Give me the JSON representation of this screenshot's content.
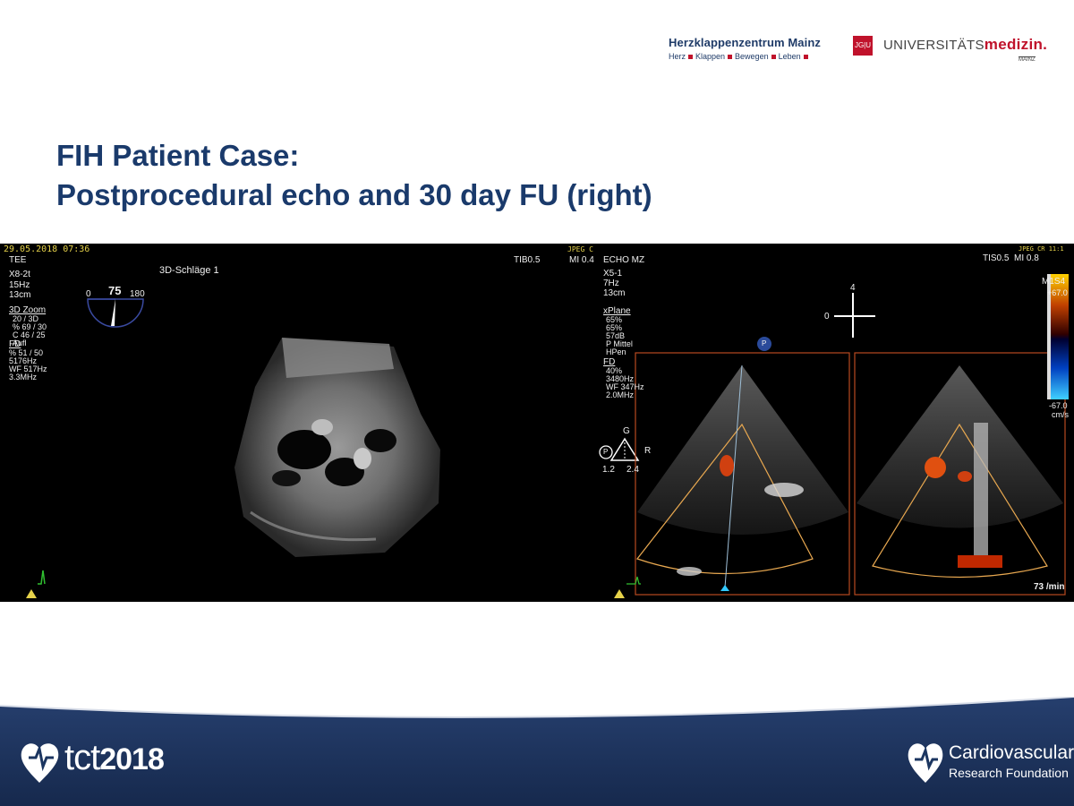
{
  "header": {
    "logo1_name": "Herzklappenzentrum Mainz",
    "logo1_tagline": [
      "Herz",
      "Klappen",
      "Bewegen",
      "Leben"
    ],
    "jgu_mark": "JG|U",
    "unimed_prefix": "UNIVERSITÄTS",
    "unimed_bold": "medizin.",
    "unimed_city": "MAINZ"
  },
  "title": {
    "line1": "FIH Patient Case:",
    "line2": "Postprocedural echo and 30 day FU (right)"
  },
  "echo_left": {
    "timestamp": "29.05.2018 07:36",
    "probe_mode": "TEE",
    "probe": "X8-2t",
    "frame_rate": "15Hz",
    "depth": "13cm",
    "zoom_label": "3D Zoom",
    "zoom_lines": [
      "20 / 3D",
      "% 69 / 30",
      "C 46 / 25",
      "Aufl"
    ],
    "fd_label": "FD",
    "fd_lines": [
      "% 51 / 50",
      "5176Hz",
      "WF 517Hz",
      "3.3MHz"
    ],
    "view_label": "3D-Schläge 1",
    "angle_min": "0",
    "angle_value": "75",
    "angle_max": "180",
    "tib": "TIB0.5",
    "mi": "MI 0.4",
    "jpeg": "JPEG C"
  },
  "echo_right": {
    "site": "ECHO MZ",
    "probe": "X5-1",
    "frame_rate": "7Hz",
    "depth": "13cm",
    "xplane_label": "xPlane",
    "xplane_lines": [
      "65%",
      "65%",
      "57dB",
      "P Mittel",
      "HPen"
    ],
    "fd_label": "FD",
    "fd_lines": [
      "40%",
      "3480Hz",
      "WF 347Hz",
      "2.0MHz"
    ],
    "g_label": "G",
    "r_label": "R",
    "p_label": "P",
    "val1": "1.2",
    "val2": "2.4",
    "orient_top": "4",
    "orient_left": "0",
    "tis": "TIS0.5",
    "mi": "MI 0.8",
    "jpeg": "JPEG CR 11:1",
    "map_label": "M1S4",
    "scale_top": "+67.0",
    "scale_bottom": "-67.0",
    "scale_unit": "cm/s",
    "heart_rate": "73 /min"
  },
  "footer": {
    "tct_prefix": "tct",
    "tct_year": "2018",
    "crf_line1": "Cardiovascular",
    "crf_line2": "Research Foundation"
  },
  "colors": {
    "title": "#1a3a6b",
    "footer_dark": "#1b3560",
    "brand_red": "#c0122b",
    "sector_outline": "#e8a850"
  }
}
